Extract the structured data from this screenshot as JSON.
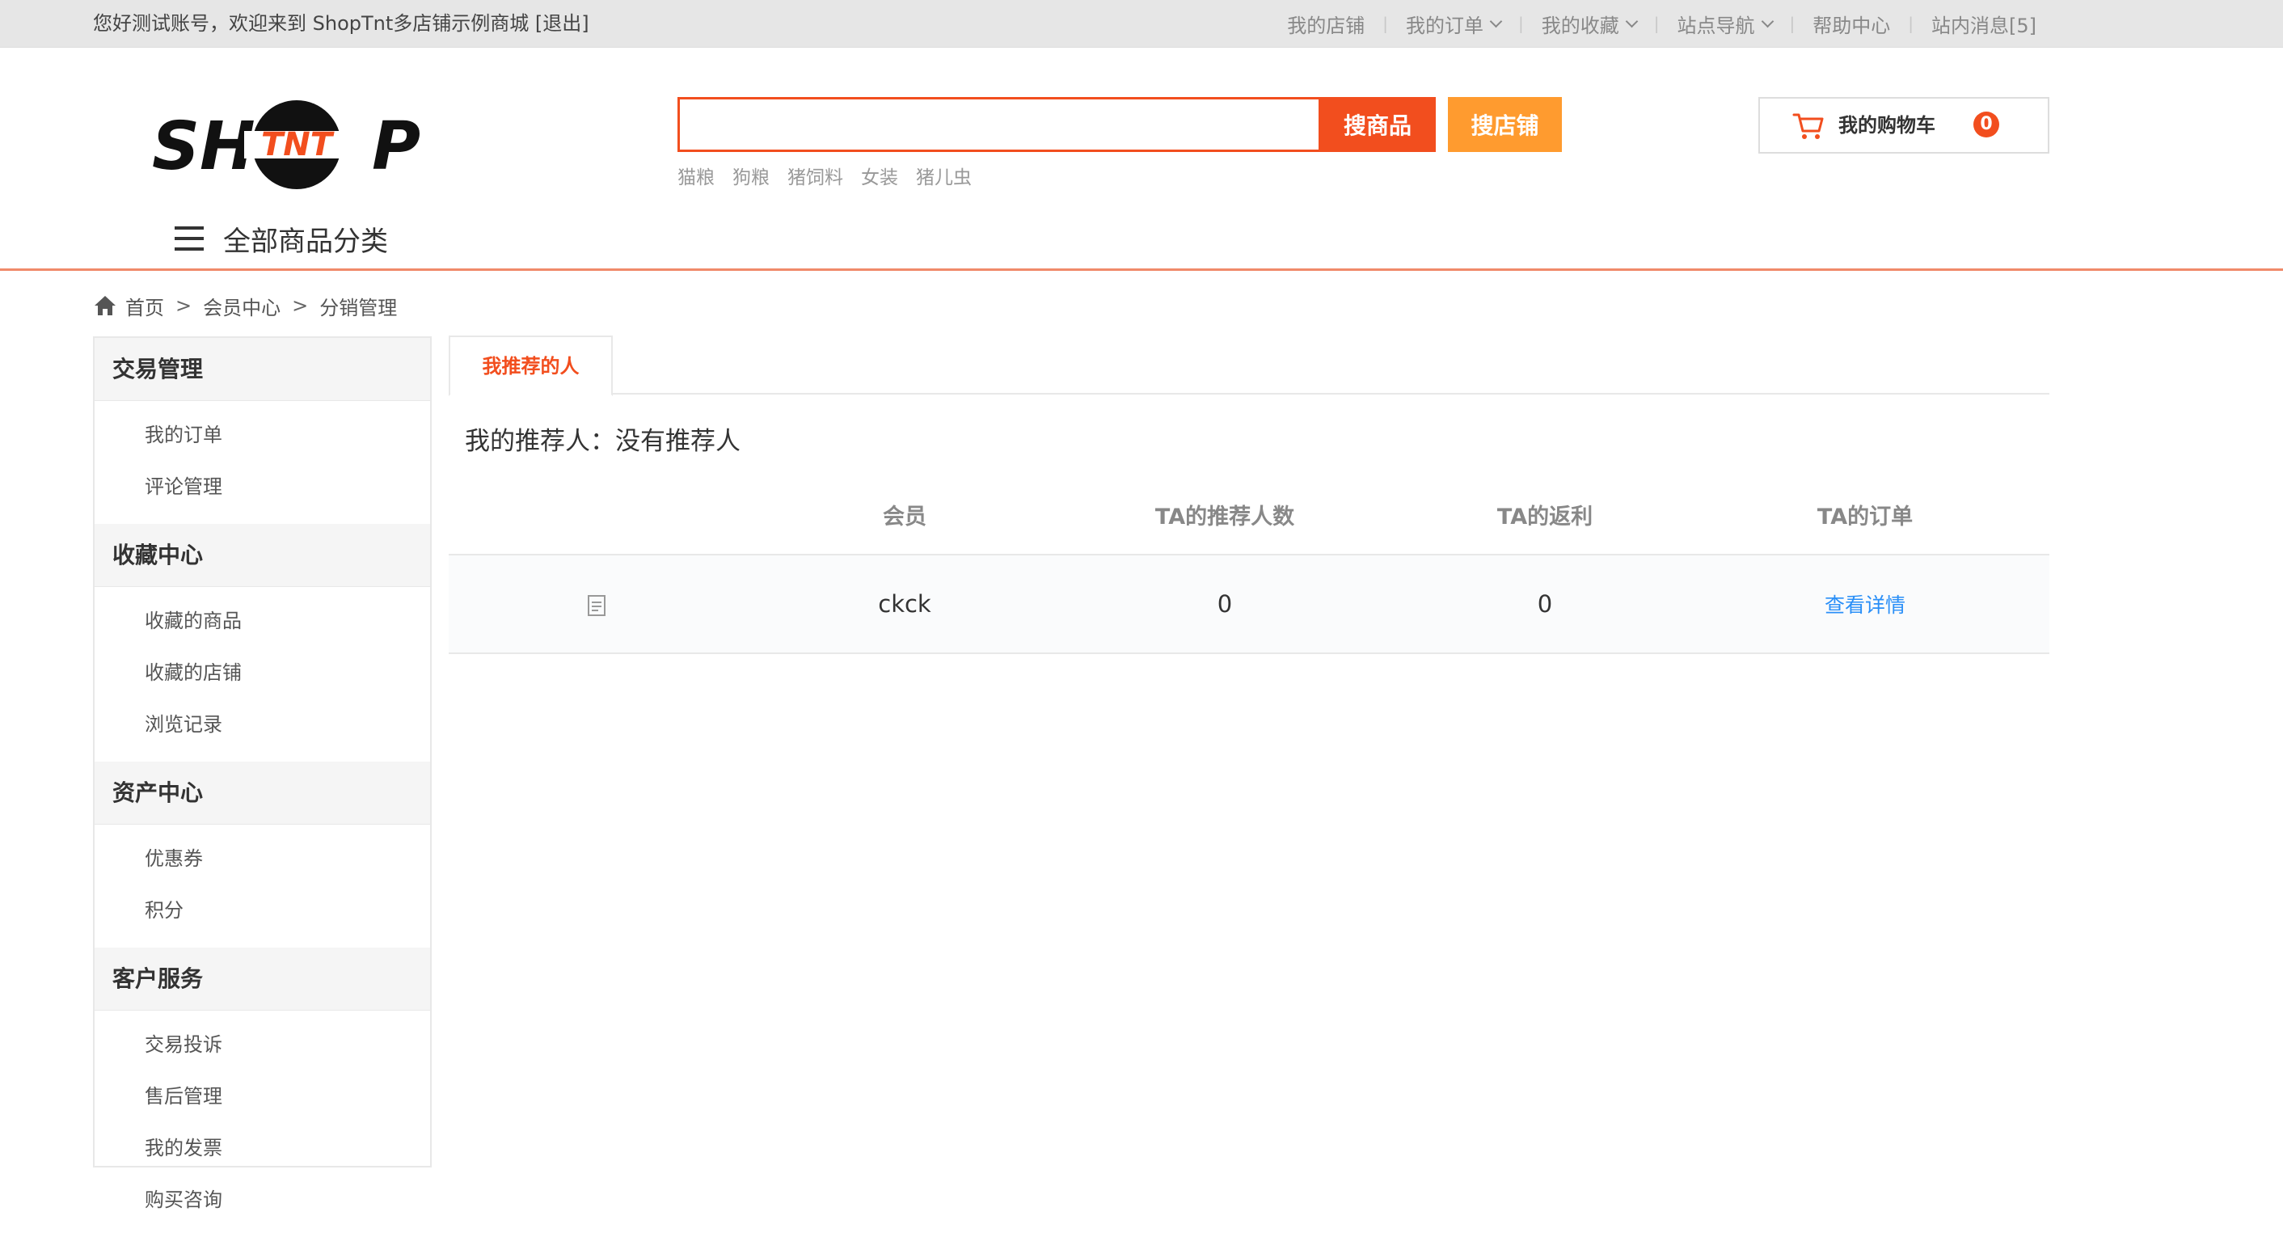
{
  "topbar": {
    "greeting": "您好测试账号，欢迎来到 ShopTnt多店铺示例商城",
    "logout": "[退出]",
    "nav": [
      {
        "label": "我的店铺",
        "dropdown": false
      },
      {
        "label": "我的订单",
        "dropdown": true
      },
      {
        "label": "我的收藏",
        "dropdown": true
      },
      {
        "label": "站点导航",
        "dropdown": true
      },
      {
        "label": "帮助中心",
        "dropdown": false
      },
      {
        "label": "站内消息[5]",
        "dropdown": false
      }
    ]
  },
  "header": {
    "logo_text": "SHTNTP",
    "search": {
      "value": "",
      "placeholder": ""
    },
    "search_goods_label": "搜商品",
    "search_shop_label": "搜店铺",
    "hot_words": [
      "猫粮",
      "狗粮",
      "猪饲料",
      "女装",
      "猪儿虫"
    ],
    "cart_label": "我的购物车",
    "cart_count": "0",
    "category_label": "全部商品分类"
  },
  "breadcrumb": [
    "首页",
    "会员中心",
    "分销管理"
  ],
  "sidebar": [
    {
      "title": "交易管理",
      "items": [
        "我的订单",
        "评论管理"
      ]
    },
    {
      "title": "收藏中心",
      "items": [
        "收藏的商品",
        "收藏的店铺",
        "浏览记录"
      ]
    },
    {
      "title": "资产中心",
      "items": [
        "优惠券",
        "积分"
      ]
    },
    {
      "title": "客户服务",
      "items": [
        "交易投诉",
        "售后管理",
        "我的发票",
        "购买咨询"
      ]
    }
  ],
  "main": {
    "tab_label": "我推荐的人",
    "referrer_text": "我的推荐人：没有推荐人",
    "columns": [
      "",
      "会员",
      "TA的推荐人数",
      "TA的返利",
      "TA的订单"
    ],
    "rows": [
      {
        "member": "ckck",
        "referrals": "0",
        "rebate": "0",
        "orders_link": "查看详情"
      }
    ]
  },
  "colors": {
    "accent": "#f24e1e",
    "orange": "#ff9b2f",
    "link": "#2a8ff7"
  }
}
